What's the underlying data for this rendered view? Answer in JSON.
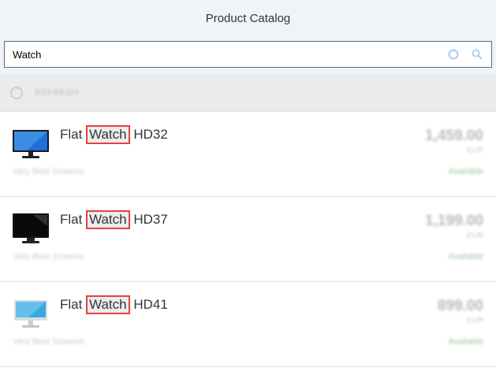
{
  "header": {
    "title": "Product Catalog"
  },
  "search": {
    "value": "Watch",
    "refresh_icon": "refresh-icon",
    "search_icon": "search-icon"
  },
  "refresh": {
    "label": "REFRESH"
  },
  "products": [
    {
      "prefix": "Flat ",
      "highlight": "Watch",
      "suffix": " HD32",
      "description": "Very Best Screens",
      "price": "1,459.00",
      "currency": "EUR",
      "status": "Available",
      "screen_color": "#1e6fd8"
    },
    {
      "prefix": "Flat ",
      "highlight": "Watch",
      "suffix": " HD37",
      "description": "Very Best Screens",
      "price": "1,199.00",
      "currency": "EUR",
      "status": "Available",
      "screen_color": "#111111"
    },
    {
      "prefix": "Flat ",
      "highlight": "Watch",
      "suffix": " HD41",
      "description": "Very Best Screens",
      "price": "899.00",
      "currency": "EUR",
      "status": "Available",
      "screen_color": "#3aa9e0"
    }
  ]
}
